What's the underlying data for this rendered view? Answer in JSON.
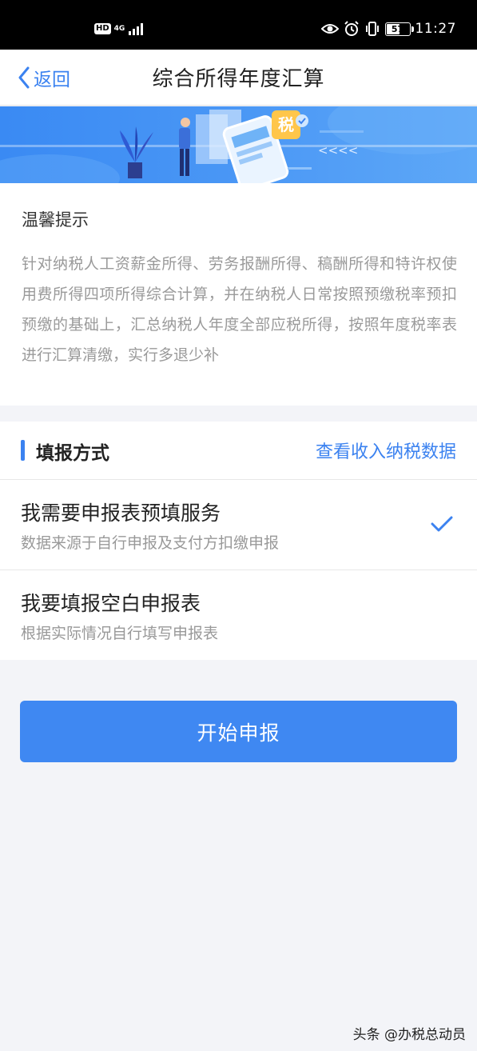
{
  "status_bar": {
    "hd": "HD",
    "network": "4G",
    "battery": "57",
    "time": "11:27"
  },
  "nav": {
    "back_label": "返回",
    "title": "综合所得年度汇算"
  },
  "banner": {
    "tax_badge": "税",
    "arrows": "<<<<"
  },
  "tip": {
    "title": "温馨提示",
    "body": "针对纳税人工资薪金所得、劳务报酬所得、稿酬所得和特许权使用费所得四项所得综合计算，并在纳税人日常按照预缴税率预扣预缴的基础上，汇总纳税人年度全部应税所得，按照年度税率表进行汇算清缴，实行多退少补"
  },
  "filing": {
    "title": "填报方式",
    "link": "查看收入纳税数据",
    "options": [
      {
        "title": "我需要申报表预填服务",
        "desc": "数据来源于自行申报及支付方扣缴申报",
        "selected": true
      },
      {
        "title": "我要填报空白申报表",
        "desc": "根据实际情况自行填写申报表",
        "selected": false
      }
    ]
  },
  "actions": {
    "start_label": "开始申报"
  },
  "watermark": "头条 @办税总动员",
  "colors": {
    "accent": "#3b82f0",
    "button": "#3f88f2",
    "banner": "#4a97f5",
    "background": "#f3f4f8"
  }
}
